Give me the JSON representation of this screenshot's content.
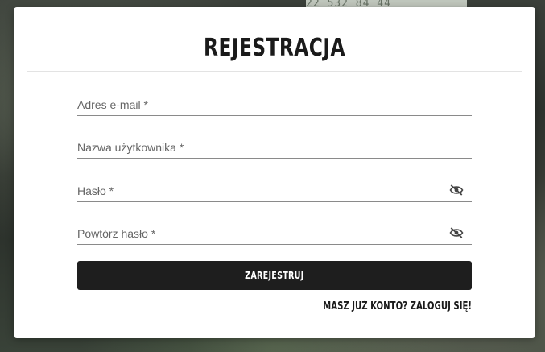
{
  "modal": {
    "title": "REJESTRACJA",
    "fields": {
      "email": {
        "placeholder": "Adres e-mail *"
      },
      "username": {
        "placeholder": "Nazwa użytkownika *"
      },
      "password": {
        "placeholder": "Hasło *",
        "icon": "eye-off-icon"
      },
      "password_repeat": {
        "placeholder": "Powtórz hasło *",
        "icon": "eye-off-icon"
      }
    },
    "submit_label": "ZAREJESTRUJ",
    "login_link": "MASZ JUŻ KONTO? ZALOGUJ SIĘ!"
  },
  "background": {
    "banner_text": "22 532 84 44"
  }
}
